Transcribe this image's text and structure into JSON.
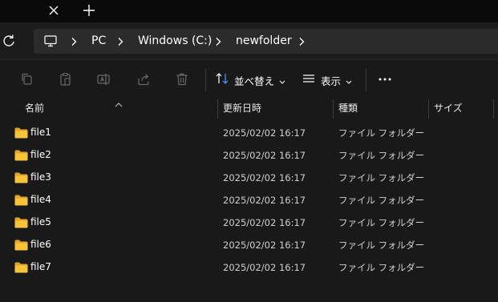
{
  "breadcrumb": [
    "PC",
    "Windows (C:)",
    "newfolder"
  ],
  "toolbar": {
    "sort_label": "並べ替え",
    "view_label": "表示",
    "more_label": "…"
  },
  "columns": {
    "name": "名前",
    "date": "更新日時",
    "type": "種類",
    "size": "サイズ"
  },
  "files": [
    {
      "name": "file1",
      "date": "2025/02/02 16:17",
      "type": "ファイル フォルダー"
    },
    {
      "name": "file2",
      "date": "2025/02/02 16:17",
      "type": "ファイル フォルダー"
    },
    {
      "name": "file3",
      "date": "2025/02/02 16:17",
      "type": "ファイル フォルダー"
    },
    {
      "name": "file4",
      "date": "2025/02/02 16:17",
      "type": "ファイル フォルダー"
    },
    {
      "name": "file5",
      "date": "2025/02/02 16:17",
      "type": "ファイル フォルダー"
    },
    {
      "name": "file6",
      "date": "2025/02/02 16:17",
      "type": "ファイル フォルダー"
    },
    {
      "name": "file7",
      "date": "2025/02/02 16:17",
      "type": "ファイル フォルダー"
    }
  ],
  "icons": {
    "folder_color": "#f8c23a",
    "accent_color": "#4a9eff"
  }
}
